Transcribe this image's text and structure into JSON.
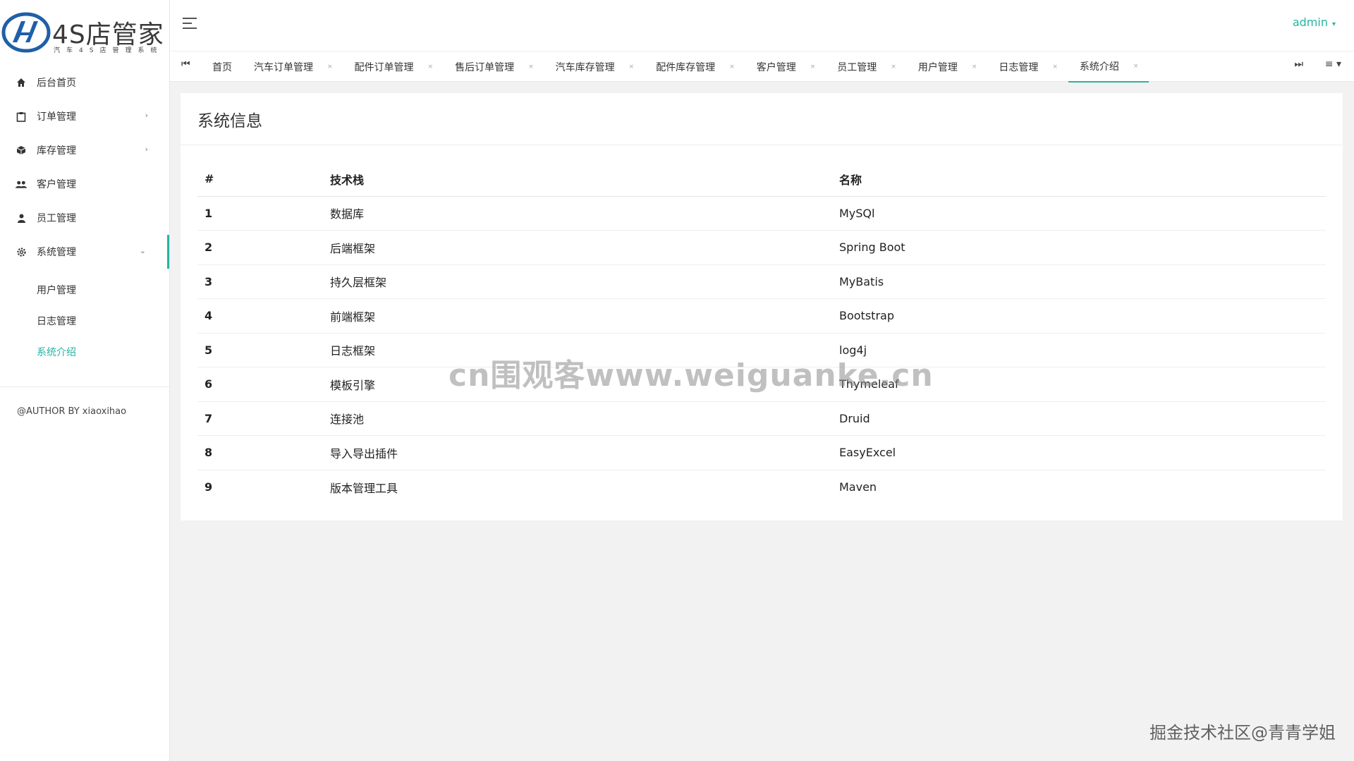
{
  "app": {
    "logo_title": "4S店管家",
    "logo_subtitle": "汽车4S店管理系统",
    "brand_color": "#24b5a3"
  },
  "sidebar": {
    "items": [
      {
        "label": "后台首页",
        "icon": "home-icon"
      },
      {
        "label": "订单管理",
        "icon": "clipboard-icon",
        "arrow": "›"
      },
      {
        "label": "库存管理",
        "icon": "cube-icon",
        "arrow": "›"
      },
      {
        "label": "客户管理",
        "icon": "users-icon"
      },
      {
        "label": "员工管理",
        "icon": "user-icon"
      },
      {
        "label": "系统管理",
        "icon": "gear-icon",
        "arrow": "⌄"
      }
    ],
    "subitems": [
      {
        "label": "用户管理"
      },
      {
        "label": "日志管理"
      },
      {
        "label": "系统介绍"
      }
    ],
    "author": "@AUTHOR BY xiaoxihao"
  },
  "header": {
    "user": "admin",
    "caret": "▾",
    "tab_prev": "⏮",
    "tab_next": "⏭",
    "tab_menu": "≡ ▾",
    "tabs": [
      {
        "label": "首页",
        "close": ""
      },
      {
        "label": "汽车订单管理",
        "close": "×"
      },
      {
        "label": "配件订单管理",
        "close": "×"
      },
      {
        "label": "售后订单管理",
        "close": "×"
      },
      {
        "label": "汽车库存管理",
        "close": "×"
      },
      {
        "label": "配件库存管理",
        "close": "×"
      },
      {
        "label": "客户管理",
        "close": "×"
      },
      {
        "label": "员工管理",
        "close": "×"
      },
      {
        "label": "用户管理",
        "close": "×"
      },
      {
        "label": "日志管理",
        "close": "×"
      },
      {
        "label": "系统介绍",
        "close": "×"
      }
    ]
  },
  "main": {
    "title": "系统信息",
    "table": {
      "headers": [
        "#",
        "技术栈",
        "名称"
      ],
      "rows": [
        [
          "1",
          "数据库",
          "MySQl"
        ],
        [
          "2",
          "后端框架",
          "Spring Boot"
        ],
        [
          "3",
          "持久层框架",
          "MyBatis"
        ],
        [
          "4",
          "前端框架",
          "Bootstrap"
        ],
        [
          "5",
          "日志框架",
          "log4j"
        ],
        [
          "6",
          "模板引擎",
          "Thymeleaf"
        ],
        [
          "7",
          "连接池",
          "Druid"
        ],
        [
          "8",
          "导入导出插件",
          "EasyExcel"
        ],
        [
          "9",
          "版本管理工具",
          "Maven"
        ]
      ]
    }
  },
  "watermarks": {
    "center": "cn围观客www.weiguanke.cn",
    "corner": "掘金技术社区@青青学姐"
  }
}
